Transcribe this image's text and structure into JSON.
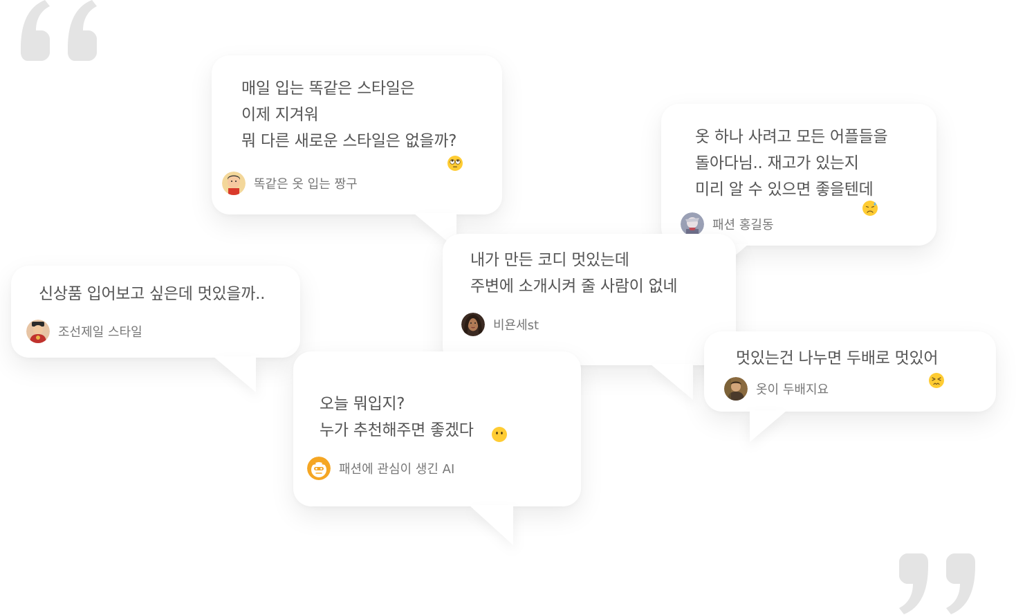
{
  "bubbles": [
    {
      "lines": [
        "매일 입는 똑같은 스타일은",
        "이제 지겨워",
        "뭐 다른 새로운 스타일은 없을까?"
      ],
      "author": "똑같은 옷 입는 짱구",
      "emoji": "eye-roll-emoji-icon"
    },
    {
      "lines": [
        "옷 하나 사려고 모든 어플들을",
        "돌아다님.. 재고가 있는지",
        "미리 알 수 있으면 좋을텐데"
      ],
      "author": "패션 홍길동",
      "emoji": "sad-sweat-emoji-icon"
    },
    {
      "lines": [
        "내가 만든 코디 멋있는데",
        "주변에 소개시켜 줄 사람이 없네"
      ],
      "author": "비욘세st"
    },
    {
      "lines": [
        "신상품 입어보고 싶은데 멋있을까.."
      ],
      "author": "조선제일 스타일"
    },
    {
      "lines": [
        "멋있는건 나누면 두배로 멋있어"
      ],
      "author": "옷이 두배지요",
      "emoji": "persevere-emoji-icon"
    },
    {
      "lines": [
        "오늘 뭐입지?",
        "누가 추천해주면 좋겠다"
      ],
      "author": "패션에 관심이 생긴 AI",
      "emoji": "no-mouth-emoji-icon"
    }
  ],
  "colors": {
    "quote": "#e4e4e4",
    "text": "#555555",
    "author": "#777777",
    "emoji": "#ffcc33",
    "ai_avatar": "#f5a623"
  }
}
